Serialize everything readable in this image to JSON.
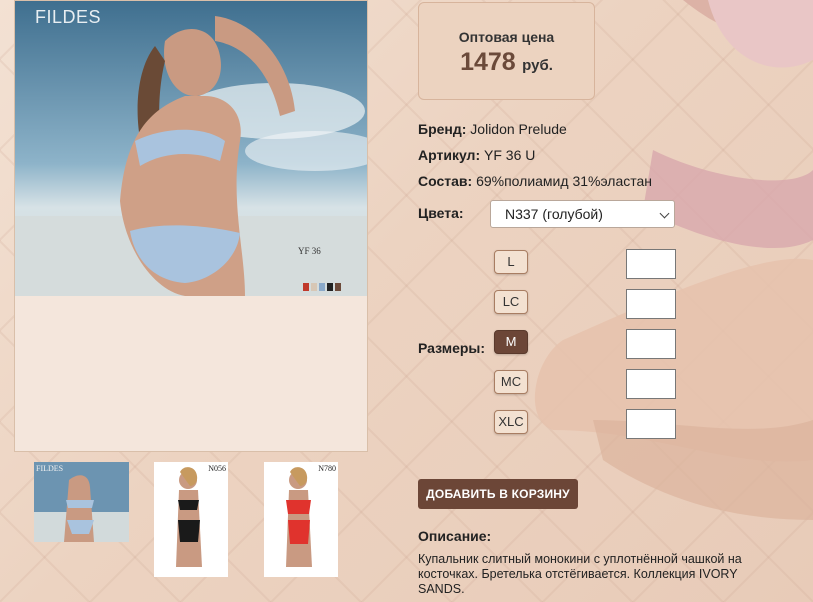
{
  "product": {
    "photo_brand": "FILDES",
    "photo_code": "YF 36",
    "thumbnails": [
      {
        "label": "FILDES"
      },
      {
        "label": "N056"
      },
      {
        "label": "N780"
      }
    ]
  },
  "price": {
    "label": "Оптовая цена",
    "value": "1478",
    "currency": "руб."
  },
  "details": {
    "brand_label": "Бренд:",
    "brand_value": "Jolidon Prelude",
    "article_label": "Артикул:",
    "article_value": "YF 36 U",
    "composition_label": "Состав:",
    "composition_value": "69%полиамид 31%эластан"
  },
  "colors": {
    "label": "Цвета:",
    "selected": "N337 (голубой)"
  },
  "sizes": {
    "label": "Размеры:",
    "options": [
      "L",
      "LC",
      "M",
      "MC",
      "XLC"
    ],
    "active": "M"
  },
  "cart": {
    "button_label": "ДОБАВИТЬ В КОРЗИНУ"
  },
  "description": {
    "title": "Описание:",
    "text": "Купальник слитный монокини с уплотнённой чашкой на косточках. Бретелька отстёгивается. Коллекция IVORY SANDS."
  },
  "theme": {
    "accent": "#6c4637",
    "price_box": "#ecd3c0",
    "background": "#ecd3c1"
  }
}
